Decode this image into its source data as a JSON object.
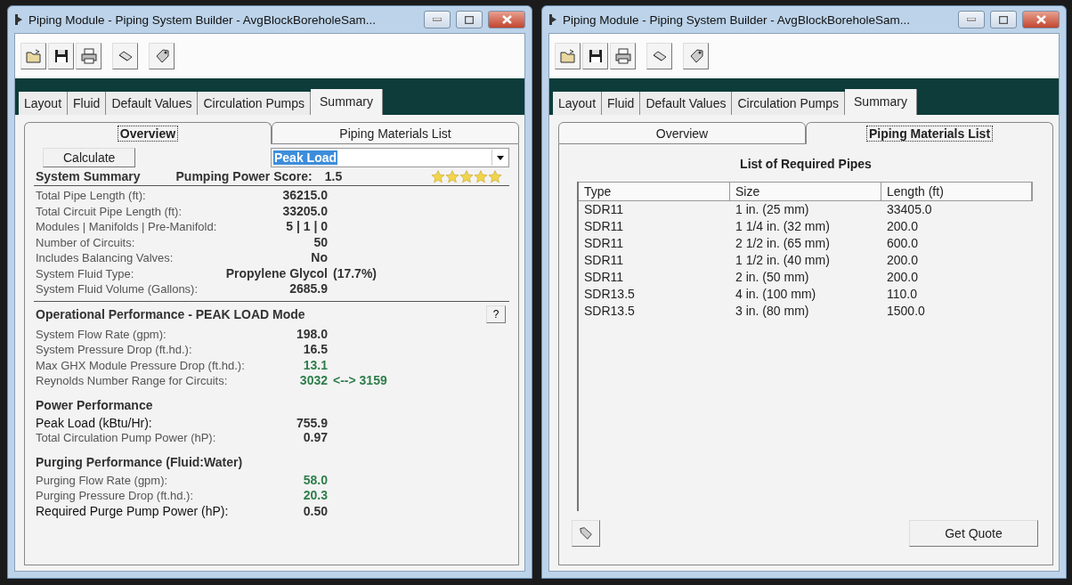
{
  "windows": [
    {
      "title": "Piping Module - Piping System Builder - AvgBlockBoreholeSam...",
      "kind": "overview",
      "tabs": [
        {
          "label": "Layout",
          "selected": false
        },
        {
          "label": "Fluid",
          "selected": false
        },
        {
          "label": "Default Values",
          "selected": false
        },
        {
          "label": "Circulation Pumps",
          "selected": false
        },
        {
          "label": "Summary",
          "selected": true
        }
      ],
      "subtabs": [
        {
          "label": "Overview",
          "selected": true
        },
        {
          "label": "Piping Materials List",
          "selected": false
        }
      ],
      "overview": {
        "calculate_button": "Calculate",
        "mode_select": {
          "value": "Peak Load"
        },
        "summary": {
          "title": "System Summary",
          "score_label": "Pumping Power Score:",
          "score": "1.5",
          "stars": 5
        },
        "summary_rows": [
          {
            "label": "Total Pipe Length (ft):",
            "value": "36215.0"
          },
          {
            "label": "Total Circuit Pipe Length (ft):",
            "value": "33205.0"
          },
          {
            "label": "Modules | Manifolds | Pre-Manifold:",
            "value": "5 | 1 | 0"
          },
          {
            "label": "Number of Circuits:",
            "value": "50"
          },
          {
            "label": "Includes Balancing Valves:",
            "value": "No"
          },
          {
            "label": "System Fluid Type:",
            "value": "Propylene Glycol",
            "extra": "(17.7%)"
          },
          {
            "label": "System Fluid Volume (Gallons):",
            "value": "2685.9"
          }
        ],
        "sections": [
          {
            "title": "Operational Performance - PEAK LOAD Mode",
            "help_button": "?",
            "rows": [
              {
                "label": "System Flow Rate (gpm):",
                "value": "198.0"
              },
              {
                "label": "System Pressure Drop (ft.hd.):",
                "value": "16.5"
              },
              {
                "label": "Max GHX Module Pressure Drop (ft.hd.):",
                "value": "13.1",
                "color": "#2e7d4a"
              },
              {
                "label": "Reynolds Number Range for Circuits:",
                "value": "3032",
                "extra": "<--> 3159",
                "color": "#2e7d4a"
              }
            ]
          },
          {
            "title": "Power Performance",
            "rows": [
              {
                "label": "Peak Load (kBtu/Hr):",
                "value": "755.9",
                "strong": true
              },
              {
                "label": "Total Circulation Pump Power (hP):",
                "value": "0.97"
              }
            ]
          },
          {
            "title": "Purging Performance (Fluid:Water)",
            "rows": [
              {
                "label": "Purging Flow Rate (gpm):",
                "value": "58.0",
                "color": "#2e7d4a"
              },
              {
                "label": "Purging Pressure Drop (ft.hd.):",
                "value": "20.3",
                "color": "#2e7d4a"
              },
              {
                "label": "Required Purge Pump Power (hP):",
                "value": "0.50",
                "strong": true
              }
            ]
          }
        ]
      }
    },
    {
      "title": "Piping Module - Piping System Builder - AvgBlockBoreholeSam...",
      "kind": "materials",
      "tabs": [
        {
          "label": "Layout",
          "selected": false
        },
        {
          "label": "Fluid",
          "selected": false
        },
        {
          "label": "Default Values",
          "selected": false
        },
        {
          "label": "Circulation Pumps",
          "selected": false
        },
        {
          "label": "Summary",
          "selected": true
        }
      ],
      "subtabs": [
        {
          "label": "Overview",
          "selected": false
        },
        {
          "label": "Piping Materials List",
          "selected": true
        }
      ],
      "materials": {
        "heading": "List of Required Pipes",
        "columns": [
          "Type",
          "Size",
          "Length (ft)"
        ],
        "rows": [
          [
            "SDR11",
            "1 in. (25 mm)",
            "33405.0"
          ],
          [
            "SDR11",
            "1 1/4 in. (32 mm)",
            "200.0"
          ],
          [
            "SDR11",
            "2 1/2 in. (65 mm)",
            "600.0"
          ],
          [
            "SDR11",
            "1 1/2 in. (40 mm)",
            "200.0"
          ],
          [
            "SDR11",
            "2 in. (50 mm)",
            "200.0"
          ],
          [
            "SDR13.5",
            "4 in. (100 mm)",
            "110.0"
          ],
          [
            "SDR13.5",
            "3 in. (80 mm)",
            "1500.0"
          ]
        ],
        "quote_button": "Get Quote"
      }
    }
  ]
}
